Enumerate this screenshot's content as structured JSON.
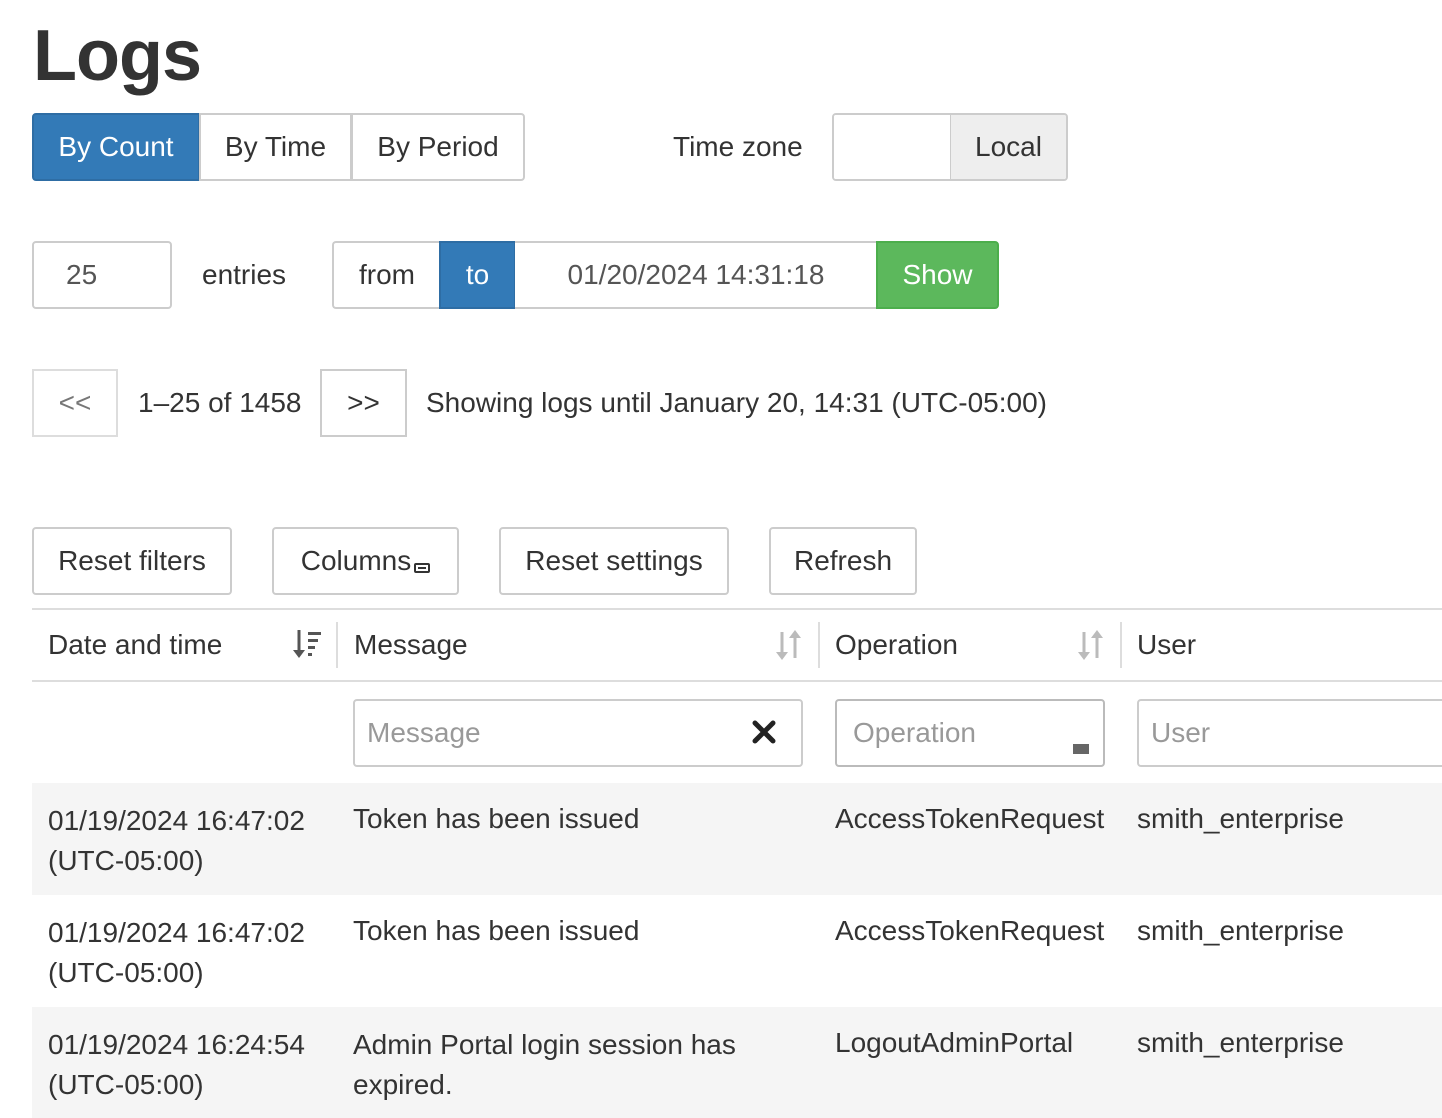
{
  "page": {
    "title": "Logs"
  },
  "mode_tabs": [
    {
      "label": "By Count",
      "active": true
    },
    {
      "label": "By Time",
      "active": false
    },
    {
      "label": "By Period",
      "active": false
    }
  ],
  "timezone": {
    "label": "Time zone",
    "value": "Local"
  },
  "query": {
    "count": "25",
    "entries_label": "entries",
    "from_label": "from",
    "to_label": "to",
    "datetime": "01/20/2024 14:31:18",
    "show_label": "Show"
  },
  "pager": {
    "prev_label": "<<",
    "range_text": "1–25 of 1458",
    "next_label": ">>",
    "status": "Showing logs until January 20, 14:31 (UTC-05:00)"
  },
  "toolbar": {
    "reset_filters": "Reset filters",
    "columns": "Columns",
    "reset_settings": "Reset settings",
    "refresh": "Refresh"
  },
  "table": {
    "columns": [
      {
        "label": "Date and time"
      },
      {
        "label": "Message"
      },
      {
        "label": "Operation"
      },
      {
        "label": "User"
      }
    ],
    "filters": {
      "message_placeholder": "Message",
      "operation_placeholder": "Operation",
      "user_placeholder": "User"
    },
    "rows": [
      {
        "date": "01/19/2024 16:47:02",
        "tz": "(UTC-05:00)",
        "message_1": "Token has been issued",
        "message_2": "",
        "operation": "AccessTokenRequest",
        "user": "smith_enterprise"
      },
      {
        "date": "01/19/2024 16:47:02",
        "tz": "(UTC-05:00)",
        "message_1": "Token has been issued",
        "message_2": "",
        "operation": "AccessTokenRequest",
        "user": "smith_enterprise"
      },
      {
        "date": "01/19/2024 16:24:54",
        "tz": "(UTC-05:00)",
        "message_1": "Admin Portal login session has",
        "message_2": "expired.",
        "operation": "LogoutAdminPortal",
        "user": "smith_enterprise"
      }
    ]
  },
  "colors": {
    "primary": "#337ab7",
    "success": "#5cb85c",
    "row_stripe": "#f5f5f5",
    "border": "#cccccc"
  }
}
